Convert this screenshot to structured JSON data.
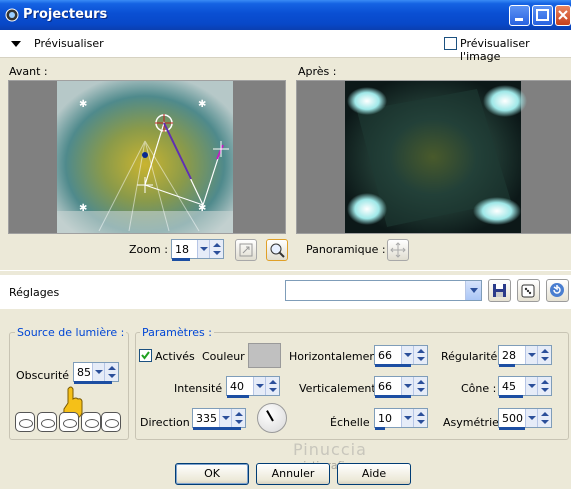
{
  "window": {
    "title": "Projecteurs"
  },
  "preview_bar": {
    "toggle_label": "Prévisualiser",
    "preview_image_label": "Prévisualiser l'image",
    "preview_image_checked": false
  },
  "previews": {
    "before_label": "Avant :",
    "after_label": "Après :"
  },
  "zoom": {
    "label": "Zoom :",
    "value": "18",
    "pan_label": "Panoramique :"
  },
  "settings": {
    "label": "Réglages",
    "preset_value": ""
  },
  "light_source": {
    "title": "Source de lumière :",
    "darkness_label": "Obscurité :",
    "darkness_value": "85"
  },
  "params": {
    "title": "Paramètres :",
    "enabled_label": "Activés",
    "enabled_checked": true,
    "color_label": "Couleur :",
    "color_value": "#c0c0c0",
    "intensity_label": "Intensité :",
    "intensity_value": "40",
    "direction_label": "Direction :",
    "direction_value": "335",
    "horizontal_label": "Horizontalement :",
    "horizontal_value": "66",
    "vertical_label": "Verticalement :",
    "vertical_value": "66",
    "scale_label": "Échelle :",
    "scale_value": "10",
    "regularity_label": "Régularité :",
    "regularity_value": "28",
    "cone_label": "Cône :",
    "cone_value": "45",
    "asymmetry_label": "Asymétrie :",
    "asymmetry_value": "500"
  },
  "watermark": {
    "name": "Pinuccia",
    "site": "www.mistigrafica.eu"
  },
  "buttons": {
    "ok": "OK",
    "cancel": "Annuler",
    "help": "Aide"
  }
}
